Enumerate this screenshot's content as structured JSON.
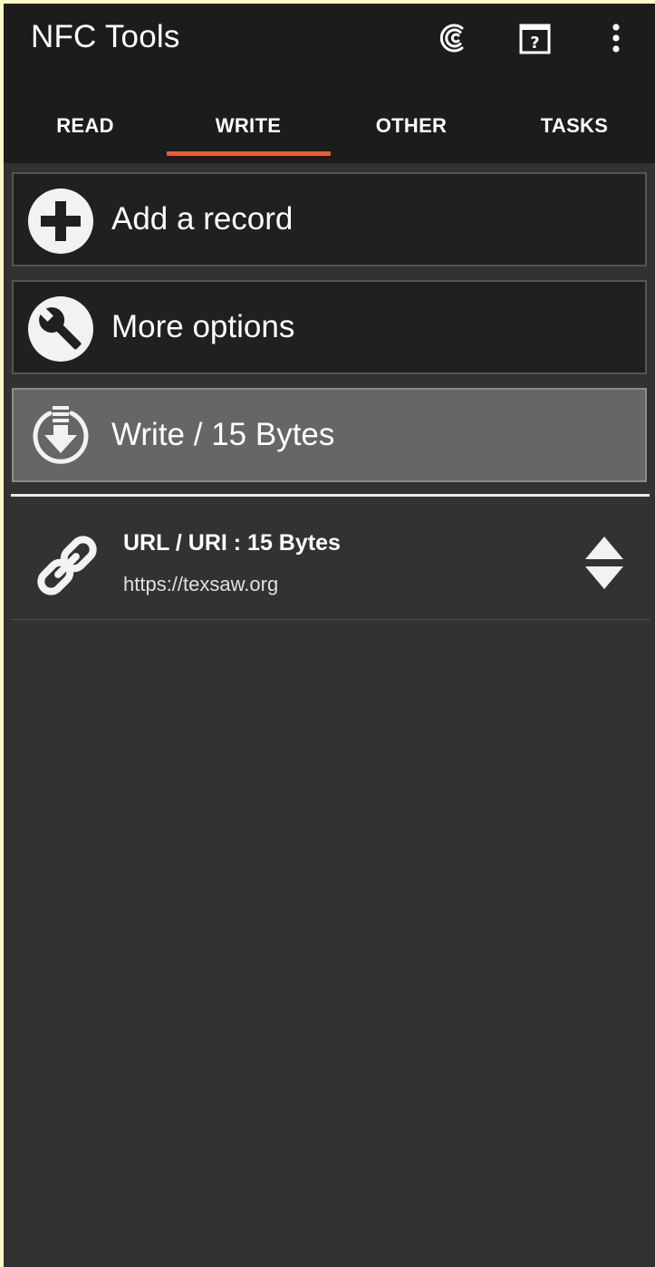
{
  "app": {
    "title": "NFC Tools"
  },
  "appbar": {
    "icons": [
      "nfc-logo-icon",
      "help-book-icon",
      "overflow-menu-icon"
    ]
  },
  "tabs": [
    {
      "label": "READ",
      "selected": false
    },
    {
      "label": "WRITE",
      "selected": true
    },
    {
      "label": "OTHER",
      "selected": false
    },
    {
      "label": "TASKS",
      "selected": false
    }
  ],
  "actions": [
    {
      "label": "Add a record",
      "icon": "plus-circle-icon"
    },
    {
      "label": "More options",
      "icon": "wrench-circle-icon"
    },
    {
      "label": "Write / 15 Bytes",
      "icon": "download-circle-icon"
    }
  ],
  "records": [
    {
      "title": "URL / URI : 15 Bytes",
      "value": "https://texsaw.org",
      "icon": "link-icon",
      "handle_icon": "reorder-arrows-icon"
    }
  ],
  "colors": {
    "accent": "#f15a2b",
    "appbar": "#1c1c1c",
    "background": "#323232",
    "active_card": "#666666"
  }
}
